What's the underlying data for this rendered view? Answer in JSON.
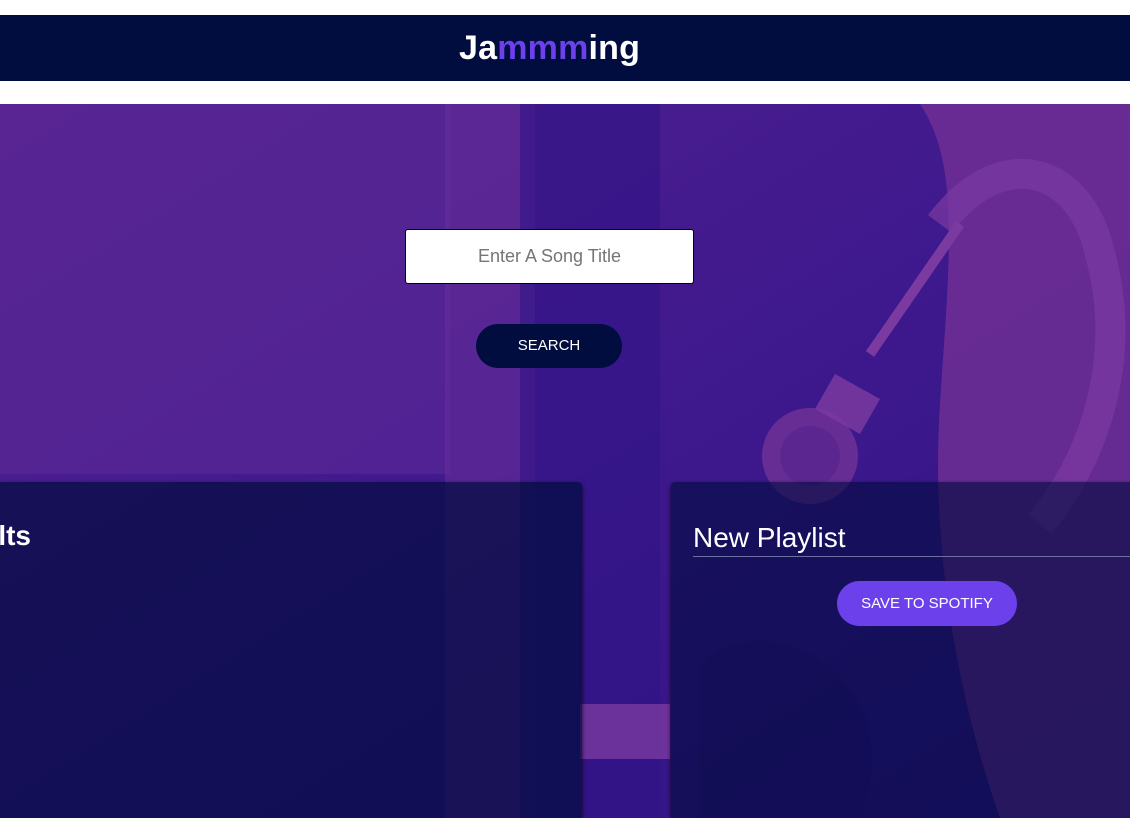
{
  "header": {
    "logo_prefix": "Ja",
    "logo_accent": "mmm",
    "logo_suffix": "ing"
  },
  "search": {
    "placeholder": "Enter A Song Title",
    "value": "",
    "button_label": "SEARCH"
  },
  "results": {
    "title": "Results"
  },
  "playlist": {
    "name_value": "New Playlist",
    "save_label": "SAVE TO SPOTIFY"
  },
  "colors": {
    "header_bg": "#010c3f",
    "accent": "#6c41ec",
    "hero_tint": "#3b1690"
  }
}
